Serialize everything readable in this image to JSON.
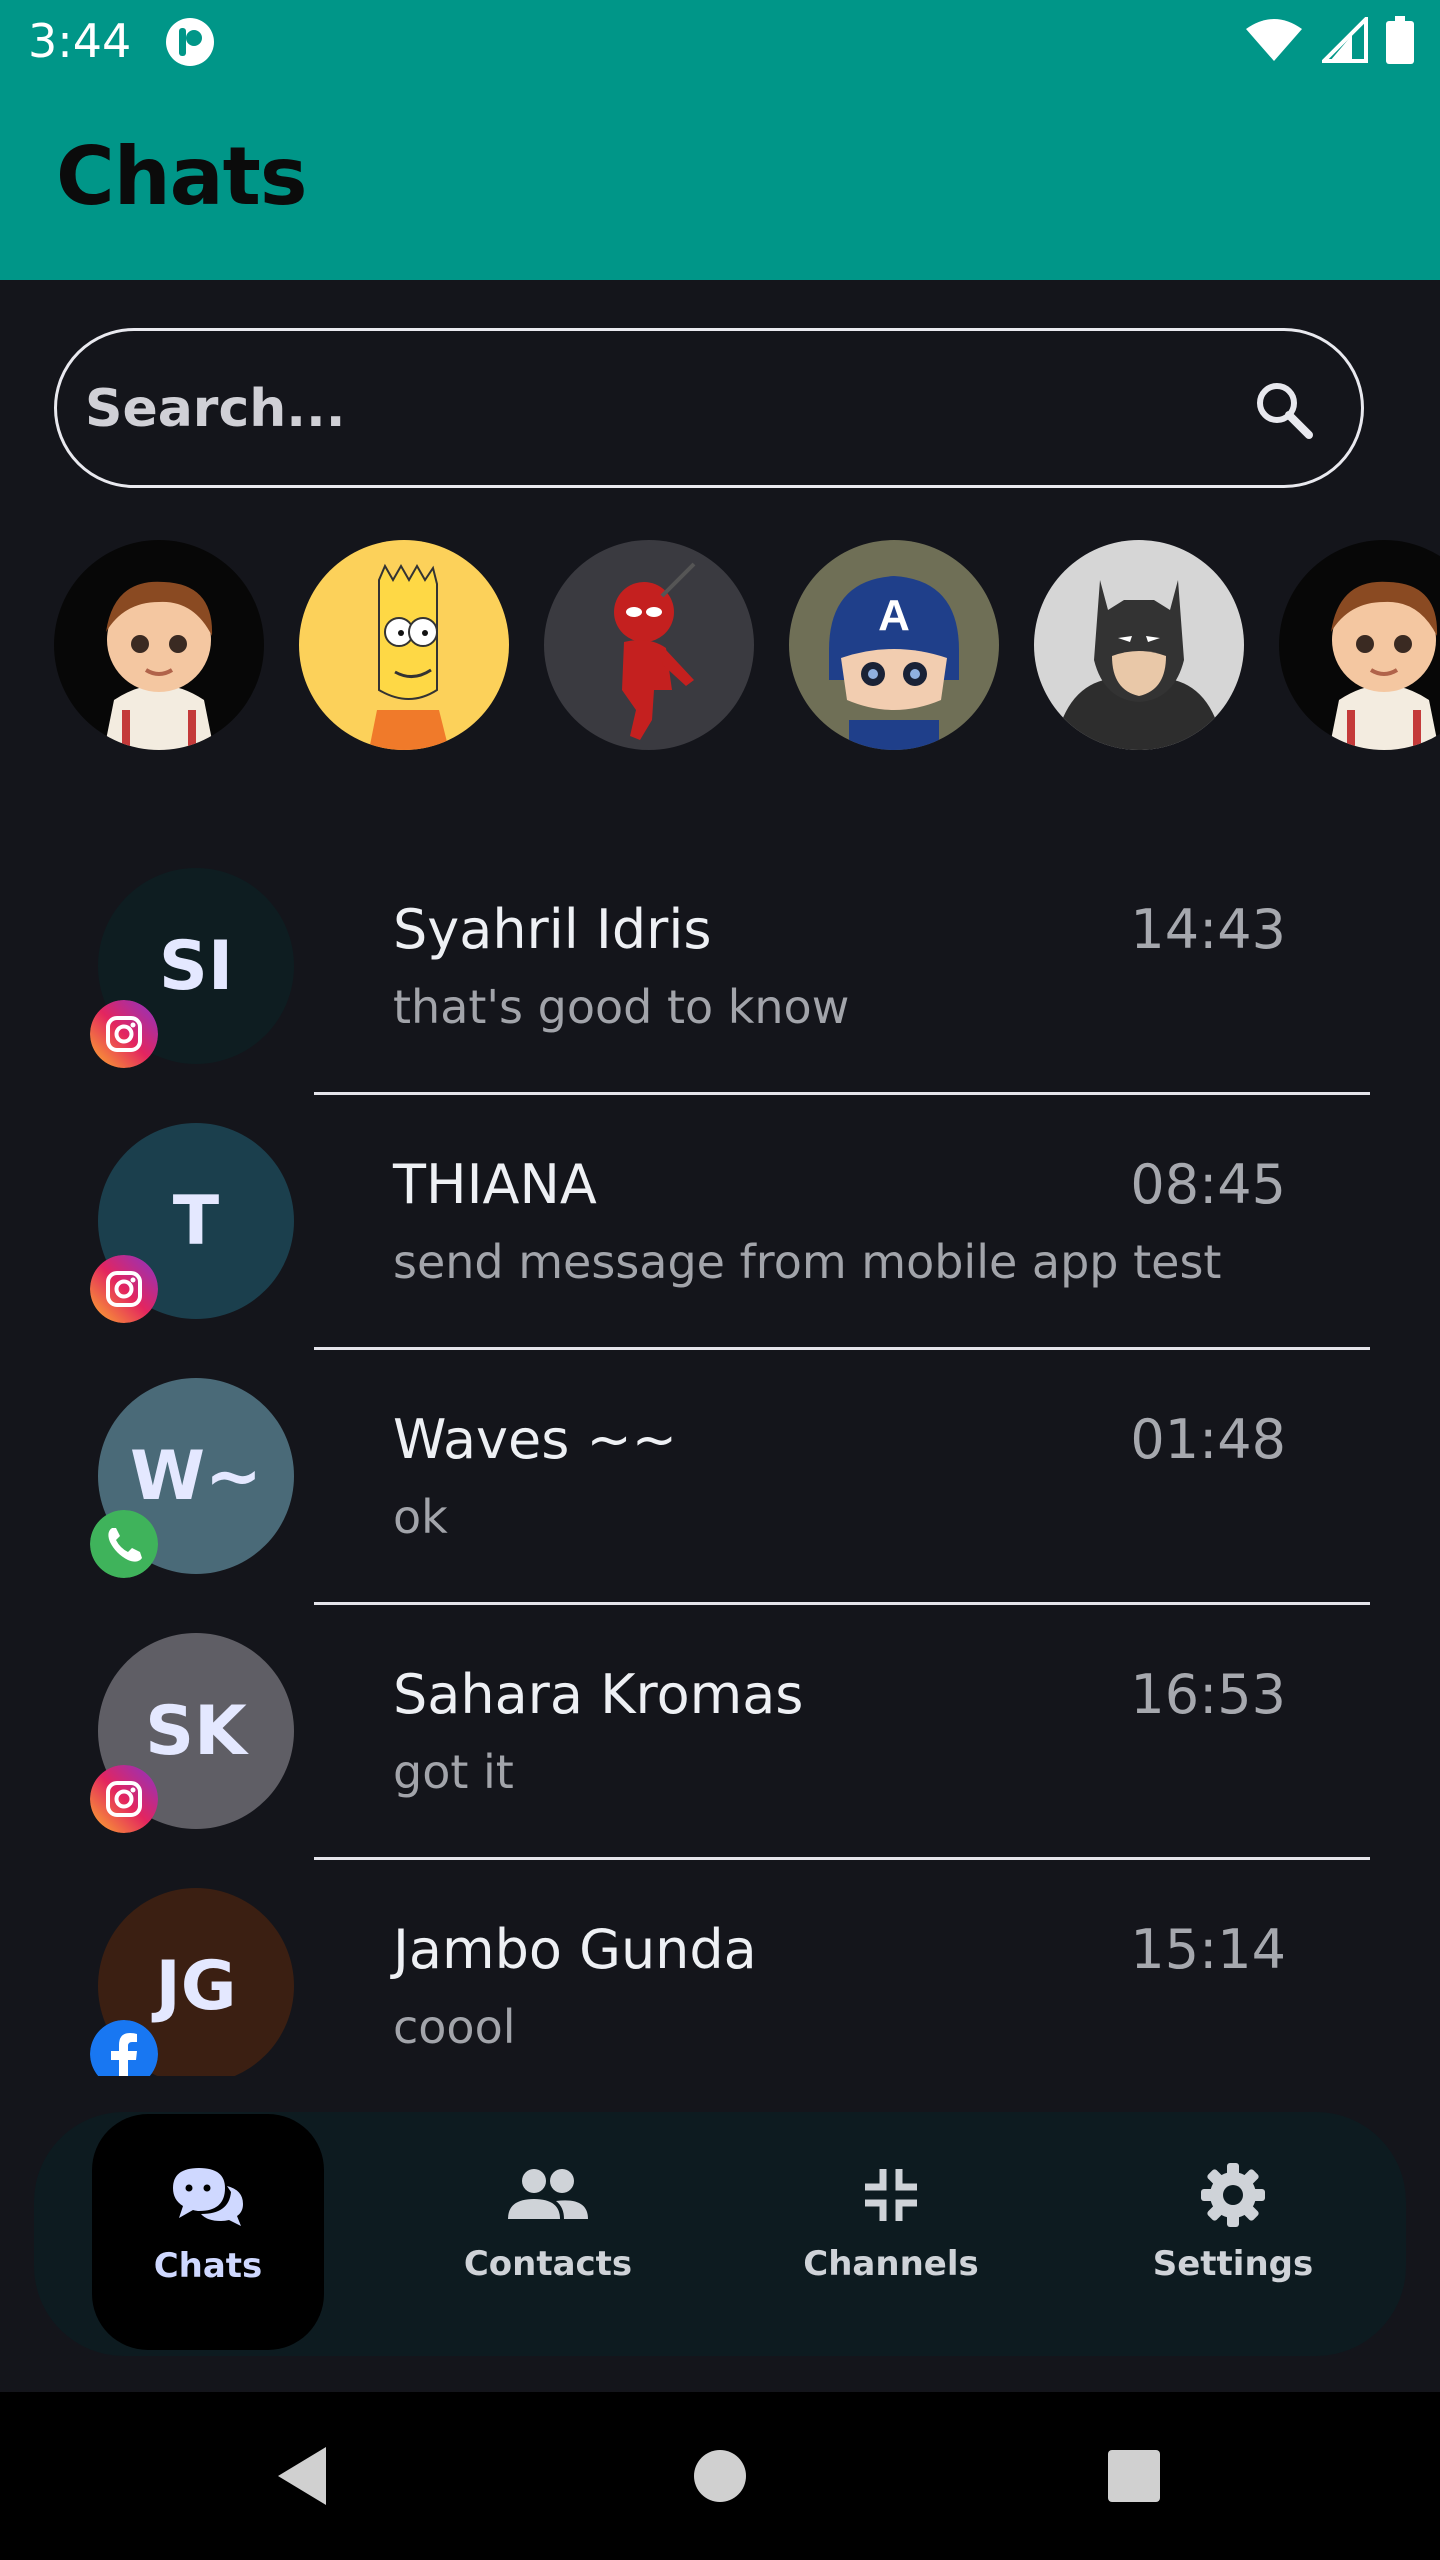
{
  "status_bar": {
    "time": "3:44"
  },
  "app_bar": {
    "title": "Chats"
  },
  "search": {
    "placeholder": "Search..."
  },
  "stories": [
    {
      "name": "boss-baby-avatar"
    },
    {
      "name": "bart-simpson-avatar"
    },
    {
      "name": "deadpool-avatar"
    },
    {
      "name": "captain-america-avatar"
    },
    {
      "name": "batman-avatar"
    },
    {
      "name": "boss-baby-avatar"
    }
  ],
  "chats": [
    {
      "initials": "SI",
      "name": "Syahril Idris",
      "time": "14:43",
      "preview": "that's good to know",
      "platform": "instagram-icon",
      "avatar_color": "#0e1d21"
    },
    {
      "initials": "T",
      "name": "THIANA",
      "time": "08:45",
      "preview": "send message from mobile app test",
      "platform": "instagram-icon",
      "avatar_color": "#1b3f4d"
    },
    {
      "initials": "W~",
      "name": "Waves ~~",
      "time": "01:48",
      "preview": "ok",
      "platform": "whatsapp-icon",
      "avatar_color": "#4a6a78"
    },
    {
      "initials": "SK",
      "name": "Sahara Kromas",
      "time": "16:53",
      "preview": "got it",
      "platform": "instagram-icon",
      "avatar_color": "#5f5e65"
    },
    {
      "initials": "JG",
      "name": "Jambo Gunda",
      "time": "15:14",
      "preview": "coool",
      "platform": "facebook-icon",
      "avatar_color": "#3b1f12"
    }
  ],
  "nav": [
    {
      "label": "Chats",
      "icon": "chat-bubbles-icon",
      "active": true
    },
    {
      "label": "Contacts",
      "icon": "contacts-icon",
      "active": false
    },
    {
      "label": "Channels",
      "icon": "channels-icon",
      "active": false
    },
    {
      "label": "Settings",
      "icon": "gear-icon",
      "active": false
    }
  ],
  "colors": {
    "app_bar": "#009688",
    "background": "#14151b",
    "nav_bg": "#0d1b20",
    "accent": "#cfd8ff"
  }
}
